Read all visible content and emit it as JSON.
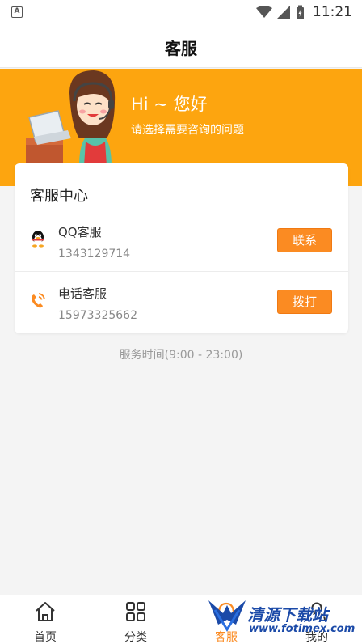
{
  "status_bar": {
    "time": "11:21"
  },
  "header": {
    "title": "客服"
  },
  "banner": {
    "greeting": "Hi ~ 您好",
    "subtitle": "请选择需要咨询的问题"
  },
  "service_card": {
    "title": "客服中心",
    "contacts": [
      {
        "name": "QQ客服",
        "number": "1343129714",
        "action": "联系",
        "icon": "qq-penguin-icon"
      },
      {
        "name": "电话客服",
        "number": "15973325662",
        "action": "拨打",
        "icon": "phone-icon"
      }
    ]
  },
  "service_hours": "服务时间(9:00 - 23:00)",
  "tabs": [
    {
      "label": "首页",
      "icon": "home-icon"
    },
    {
      "label": "分类",
      "icon": "grid-icon"
    },
    {
      "label": "客服",
      "icon": "headset-icon",
      "active": true
    },
    {
      "label": "我的",
      "icon": "user-icon"
    }
  ],
  "watermark": {
    "text": "清源下载站",
    "url": "www.fotimex.com"
  },
  "colors": {
    "accent": "#fb8b22",
    "banner": "#fda50f",
    "background": "#f4f4f4"
  }
}
